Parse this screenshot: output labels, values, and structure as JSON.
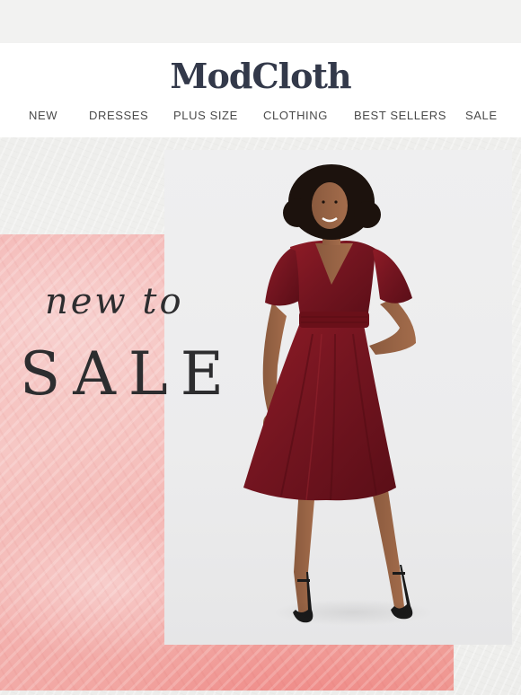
{
  "brand": {
    "logo_text": "ModCloth",
    "logo_color": "#33394a"
  },
  "nav": {
    "items": [
      {
        "label": "NEW"
      },
      {
        "label": "DRESSES"
      },
      {
        "label": "PLUS SIZE"
      },
      {
        "label": "CLOTHING"
      },
      {
        "label": "BEST SELLERS"
      },
      {
        "label": "SALE"
      }
    ]
  },
  "hero": {
    "headline_small": "new to",
    "headline_big": "SALE",
    "accent_color": "#f3b0ad",
    "dress_color": "#7e1620",
    "photo_subject": "model-in-burgundy-velvet-dress"
  }
}
